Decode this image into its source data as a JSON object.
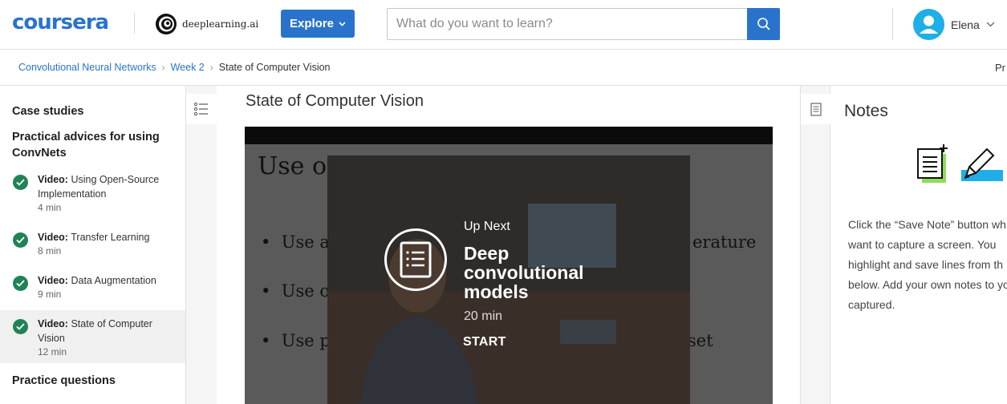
{
  "header": {
    "logo": "coursera",
    "partner": "deeplearning.ai",
    "explore_label": "Explore",
    "search_placeholder": "What do you want to learn?",
    "user_name": "Elena"
  },
  "breadcrumb": {
    "items": [
      "Convolutional Neural Networks",
      "Week 2",
      "State of Computer Vision"
    ],
    "right_text": "Pr"
  },
  "sidebar": {
    "headings": [
      "Case studies",
      "Practical advices for using ConvNets"
    ],
    "items": [
      {
        "type": "Video:",
        "title": "Using Open-Source Implementation",
        "duration": "4 min",
        "completed": true
      },
      {
        "type": "Video:",
        "title": "Transfer Learning",
        "duration": "8 min",
        "completed": true
      },
      {
        "type": "Video:",
        "title": "Data Augmentation",
        "duration": "9 min",
        "completed": true
      },
      {
        "type": "Video:",
        "title": "State of Computer Vision",
        "duration": "12 min",
        "completed": true,
        "active": true
      }
    ],
    "footer_heading": "Practice questions"
  },
  "main": {
    "title": "State of Computer Vision",
    "slide_lines": [
      "Use op",
      "Use a",
      "erature",
      "Use o",
      "Use p",
      "set"
    ],
    "up_next": {
      "label": "Up Next",
      "title": "Deep convolutional models",
      "duration": "20 min",
      "start_label": "START"
    }
  },
  "notes": {
    "title": "Notes",
    "description": "Click the “Save Note” button wh want to capture a screen. You highlight and save lines from th below. Add your own notes to you’ve captured."
  },
  "colors": {
    "brand": "#2a73cc",
    "check": "#1f8354",
    "avatar": "#1eaee8",
    "note_green": "#8fdc5a",
    "note_cyan": "#1eaee8"
  }
}
